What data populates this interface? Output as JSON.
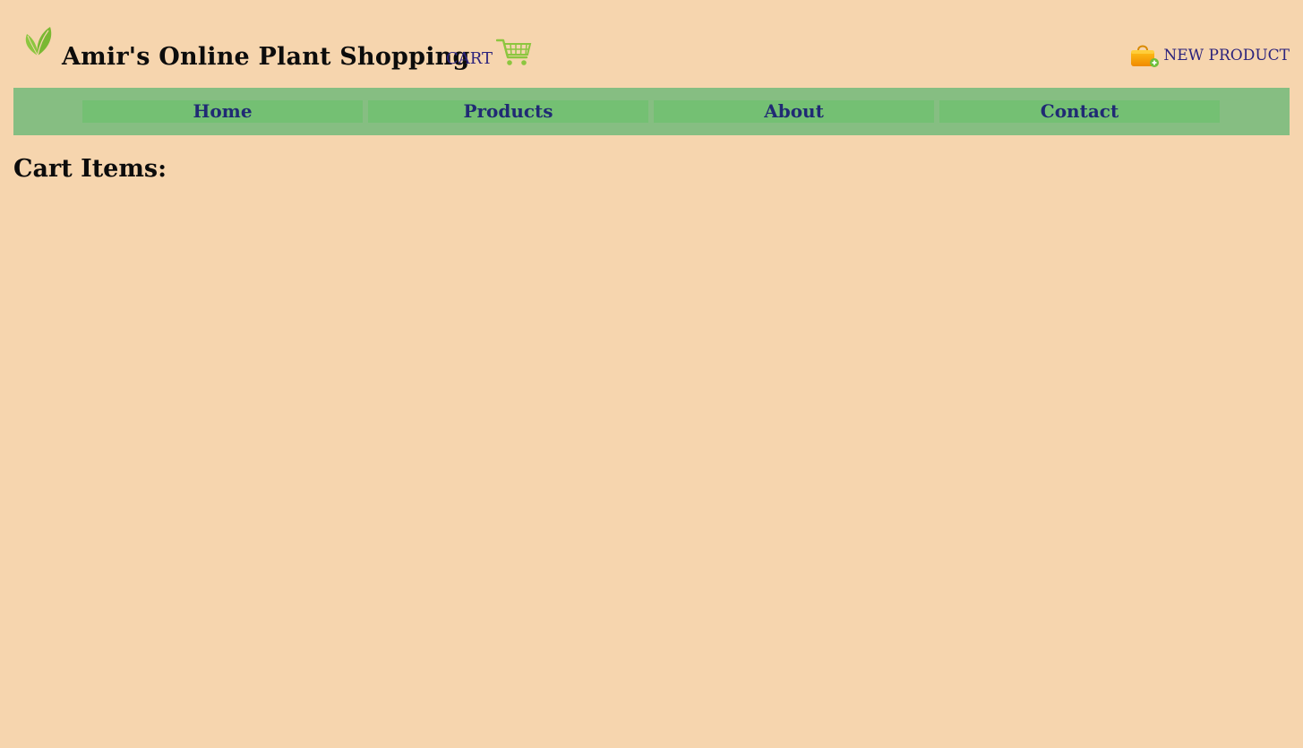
{
  "header": {
    "logo_icon": "leaf-icon",
    "title": "Amir's Online Plant Shopping",
    "cart_label": "CART",
    "cart_icon": "shopping-cart-icon",
    "new_product_label": "NEW PRODUCT",
    "new_product_icon": "shopping-bag-add-icon"
  },
  "nav": {
    "items": [
      {
        "label": "Home"
      },
      {
        "label": "Products"
      },
      {
        "label": "About"
      },
      {
        "label": "Contact"
      }
    ]
  },
  "main": {
    "heading": "Cart Items:"
  },
  "colors": {
    "background": "#f6d5ae",
    "navbar": "#86be82",
    "nav_item": "#74c073",
    "nav_text": "#202a74",
    "link_text": "#2c237c",
    "leaf_green": "#8cc63f"
  }
}
